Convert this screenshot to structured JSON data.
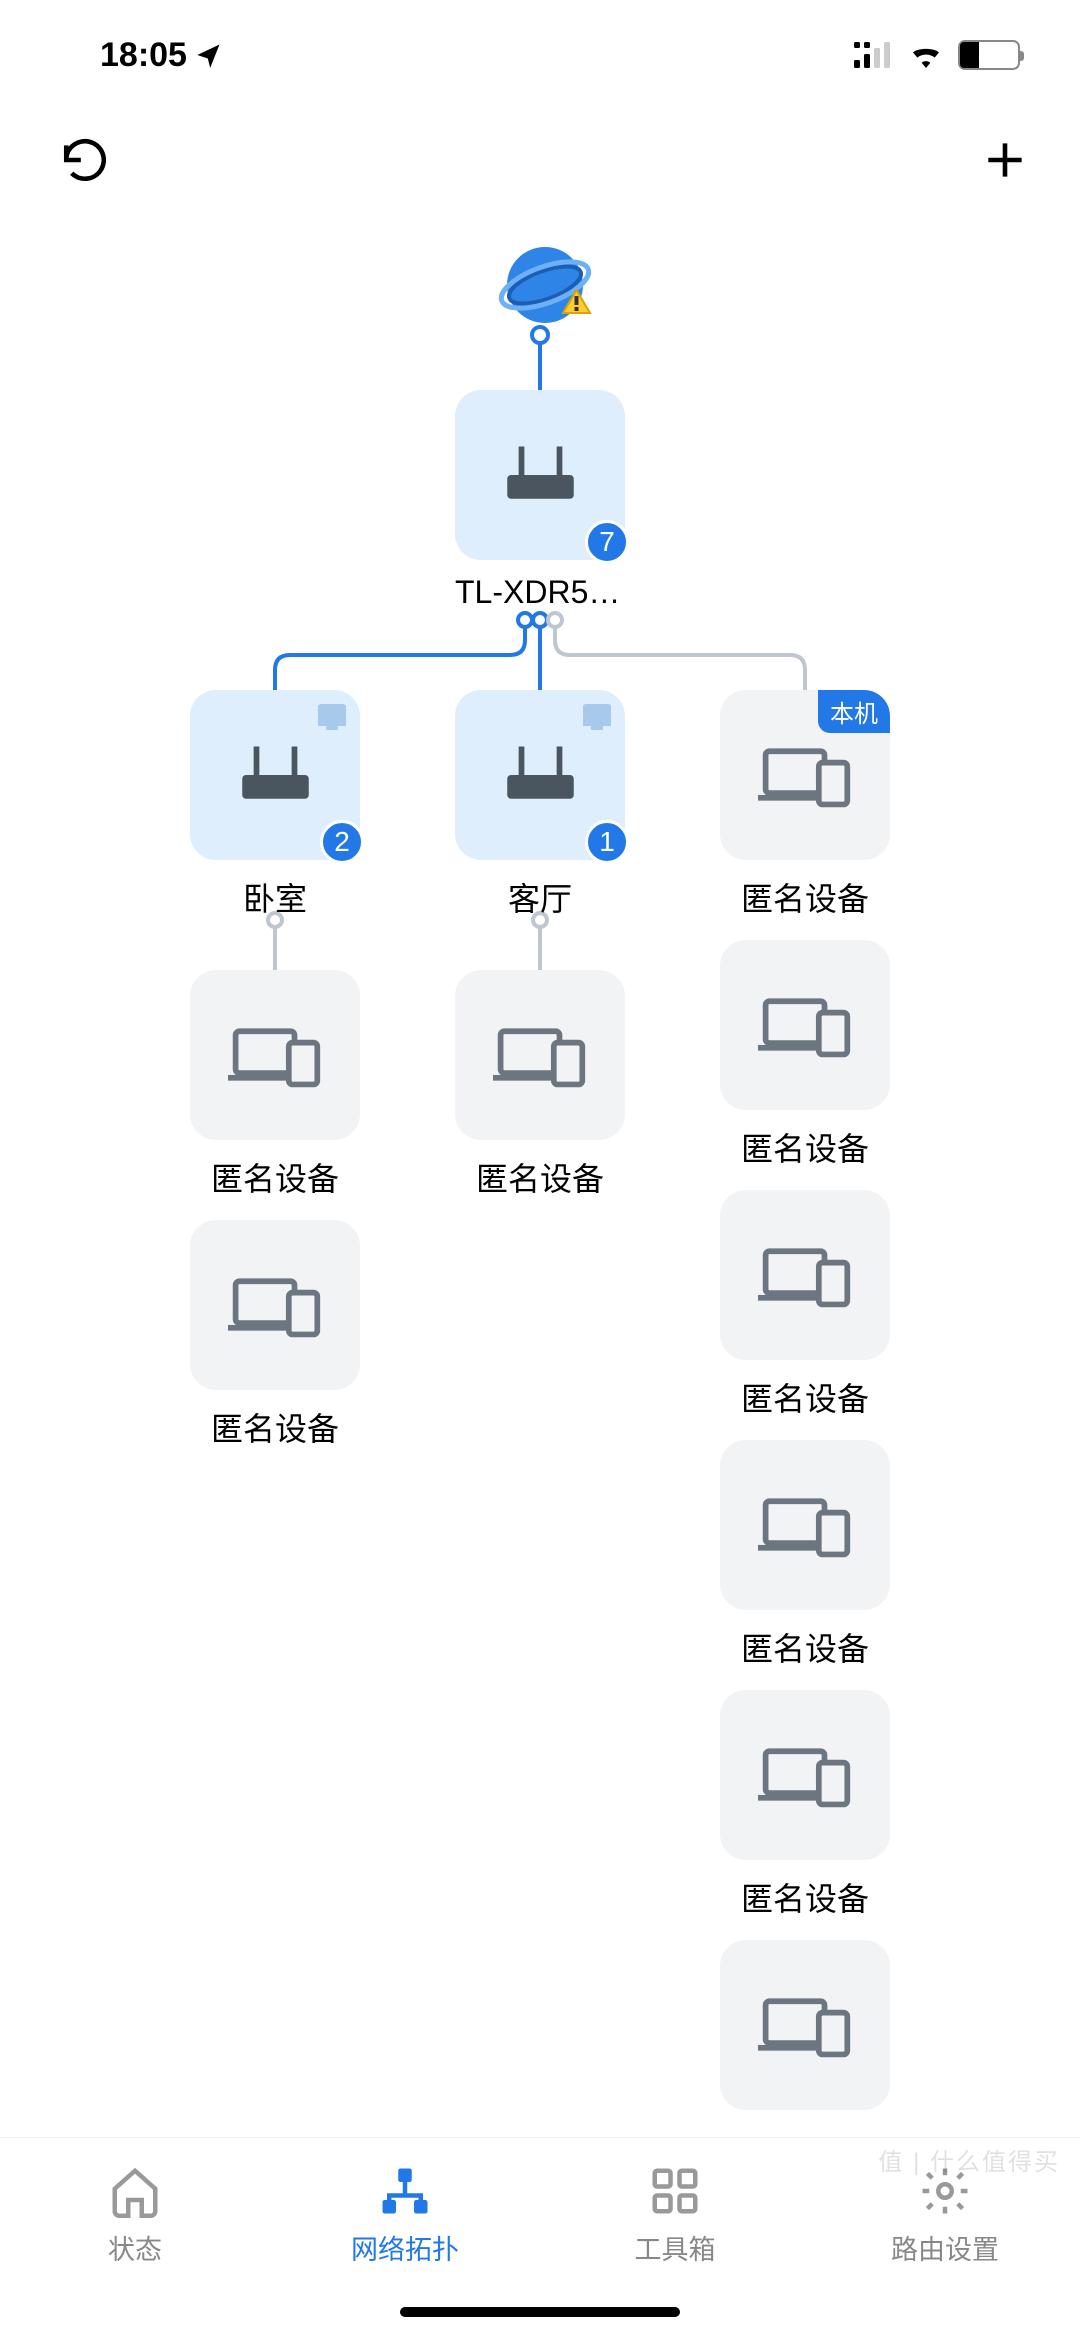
{
  "status": {
    "time": "18:05",
    "battery": "32"
  },
  "rootRouter": {
    "label": "TL-XDR54...",
    "count": "7"
  },
  "col1": {
    "router": {
      "label": "卧室",
      "count": "2"
    },
    "devices": [
      "匿名设备",
      "匿名设备"
    ]
  },
  "col2": {
    "router": {
      "label": "客厅",
      "count": "1"
    },
    "devices": [
      "匿名设备"
    ]
  },
  "col3": {
    "tag": "本机",
    "devices": [
      "匿名设备",
      "匿名设备",
      "匿名设备",
      "匿名设备",
      "匿名设备",
      ""
    ]
  },
  "tabs": {
    "status": "状态",
    "topology": "网络拓扑",
    "tools": "工具箱",
    "settings": "路由设置"
  },
  "watermark": "值 | 什么值得买"
}
